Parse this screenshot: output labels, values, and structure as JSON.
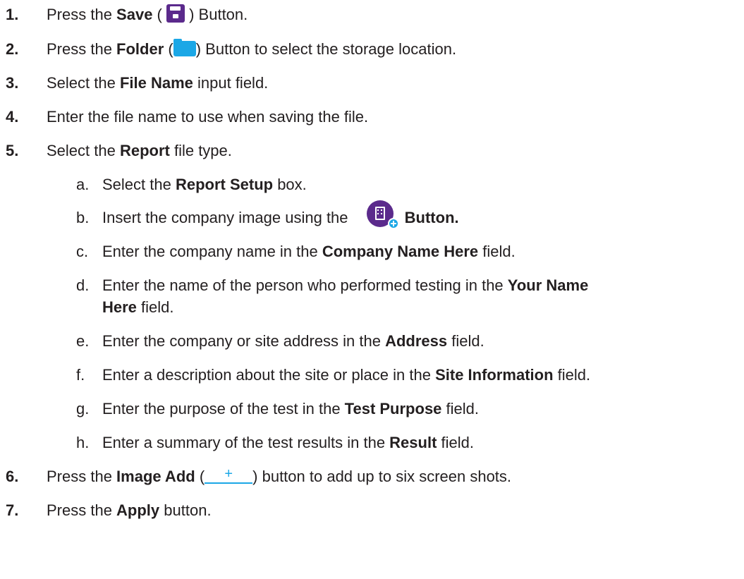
{
  "steps": [
    {
      "num": "1.",
      "pre": "Press the ",
      "bold": "Save",
      "post_open": " ( ",
      "post": " ) Button.",
      "icon": "save-icon"
    },
    {
      "num": "2.",
      "pre": "Press the ",
      "bold": "Folder",
      "post_open": " (",
      "post": ") Button to select the storage location.",
      "icon": "folder-icon"
    },
    {
      "num": "3.",
      "pre": "Select the ",
      "bold": "File Name",
      "post": " input field."
    },
    {
      "num": "4.",
      "text": "Enter the file name to use when saving the file."
    },
    {
      "num": "5.",
      "pre": "Select the ",
      "bold": "Report",
      "post": " file type."
    },
    {
      "num": "6.",
      "pre": "Press the ",
      "bold": "Image Add",
      "post_open": " (",
      "post": ") button to add up to six screen shots.",
      "icon": "image-add-icon",
      "icon_text": "+"
    },
    {
      "num": "7.",
      "pre": "Press the ",
      "bold": "Apply",
      "post": " button."
    }
  ],
  "substeps": [
    {
      "letter": "a.",
      "pre": "Select the ",
      "bold": "Report Setup",
      "post": " box."
    },
    {
      "letter": "b.",
      "pre": "Insert the company image using the ",
      "bold": "Button.",
      "icon": "company-image-icon"
    },
    {
      "letter": "c.",
      "pre": "Enter the company name in the ",
      "bold": "Company Name Here",
      "post": " field."
    },
    {
      "letter": "d.",
      "pre": "Enter the name of the person who performed testing in the ",
      "bold": "Your Name",
      "line2_bold": "Here",
      "line2_post": " field."
    },
    {
      "letter": "e.",
      "pre": "Enter the company or site address in the ",
      "bold": "Address",
      "post": " field."
    },
    {
      "letter": "f.",
      "pre": "Enter a description about the site or place in the ",
      "bold": "Site Information",
      "post": " field."
    },
    {
      "letter": "g.",
      "pre": "Enter the purpose of the test in the ",
      "bold": "Test Purpose",
      "post": " field."
    },
    {
      "letter": "h.",
      "pre": "Enter a summary of the test results in the ",
      "bold": "Result",
      "post": " field."
    }
  ]
}
